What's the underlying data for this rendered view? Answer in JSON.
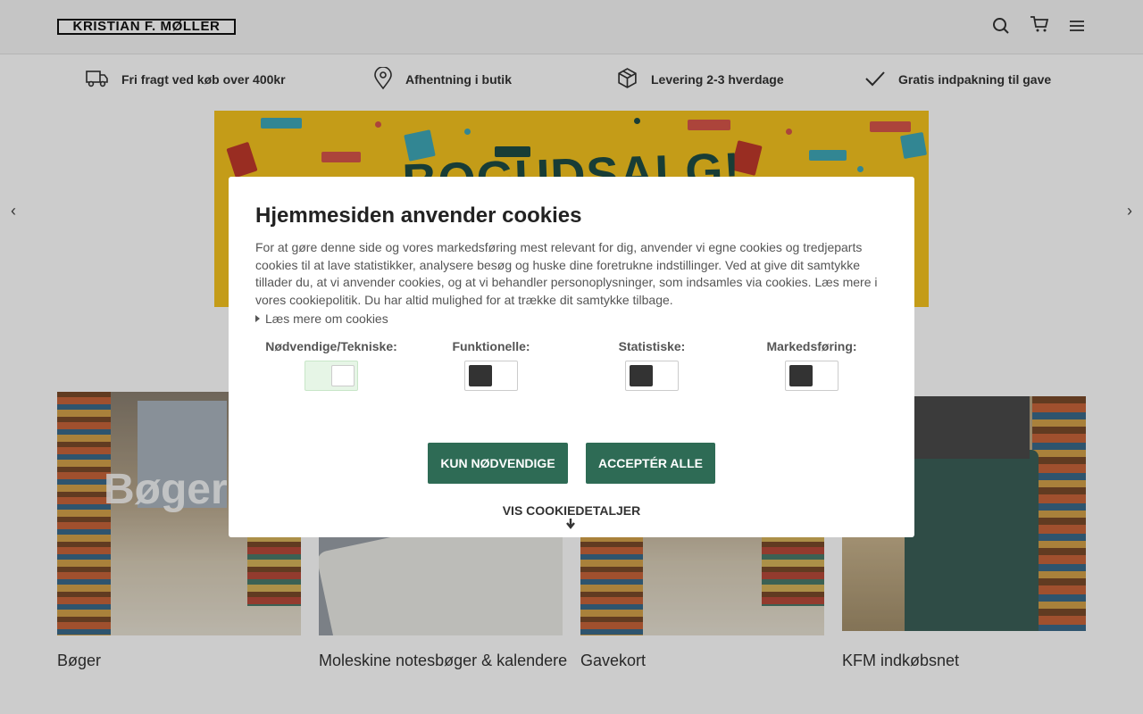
{
  "header": {
    "logo_text": "KRISTIAN F. MØLLER",
    "icons": [
      "search-icon",
      "cart-icon",
      "menu-icon"
    ]
  },
  "usps": [
    {
      "icon": "truck-icon",
      "label": "Fri fragt ved køb over 400kr"
    },
    {
      "icon": "location-pin-icon",
      "label": "Afhentning i butik"
    },
    {
      "icon": "package-icon",
      "label": "Levering 2-3 hverdage"
    },
    {
      "icon": "checkmark-icon",
      "label": "Gratis indpakning til gave"
    }
  ],
  "hero": {
    "title": "BOGUDSALG!",
    "background": "#f5c41f",
    "title_color": "#1e4d44"
  },
  "categories": [
    {
      "title": "Bøger",
      "overlay_text": "Bøger"
    },
    {
      "title": "Moleskine notesbøger & kalendere"
    },
    {
      "title": "Gavekort"
    },
    {
      "title": "KFM indkøbsnet"
    }
  ],
  "cookie_modal": {
    "title": "Hjemmesiden anvender cookies",
    "body": "For at gøre denne side og vores markedsføring mest relevant for dig, anvender vi egne cookies og tredjeparts cookies til at lave statistikker, analysere besøg og huske dine foretrukne indstillinger. Ved at give dit samtykke tillader du, at vi anvender cookies, og at vi behandler personoplysninger, som indsamles via cookies. Læs mere i vores cookiepolitik. Du har altid mulighed for at trække dit samtykke tilbage.",
    "read_more": "Læs mere om cookies",
    "options": [
      {
        "label": "Nødvendige/Tekniske:",
        "enabled": true
      },
      {
        "label": "Funktionelle:",
        "enabled": false
      },
      {
        "label": "Statistiske:",
        "enabled": false
      },
      {
        "label": "Markedsføring:",
        "enabled": false
      }
    ],
    "btn_necessary": "KUN NØDVENDIGE",
    "btn_accept_all": "ACCEPTÉR ALLE",
    "details_link": "VIS COOKIEDETALJER",
    "accent_color": "#2e6b55"
  }
}
